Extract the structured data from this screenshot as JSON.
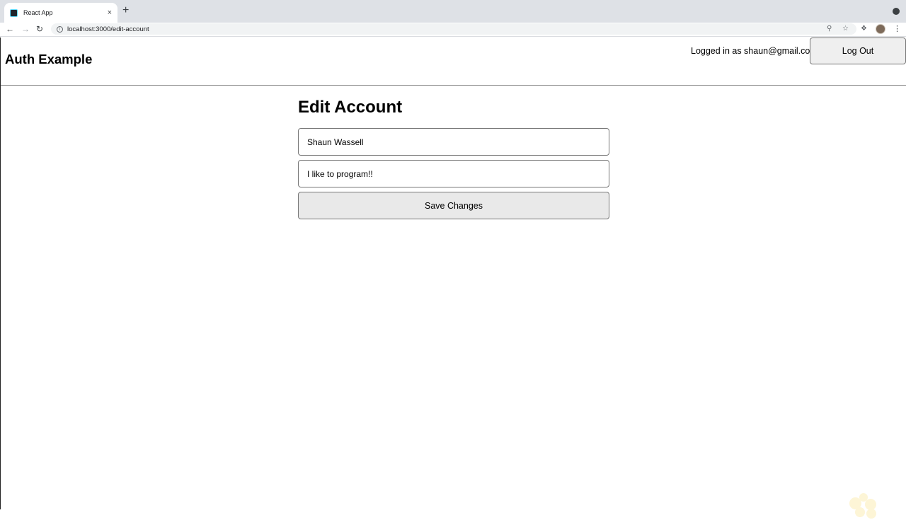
{
  "browser": {
    "tab_title": "React App",
    "tab_close": "×",
    "new_tab": "+",
    "url": "localhost:3000/edit-account",
    "icons": [
      "back-arrow-icon",
      "forward-arrow-icon",
      "reload-icon",
      "info-icon",
      "zoom-icon",
      "star-icon",
      "extensions-icon",
      "profile-avatar",
      "more-menu-icon"
    ]
  },
  "header": {
    "title": "Auth Example",
    "logged_in_text": "Logged in as shaun@gmail.com",
    "logout_label": "Log Out"
  },
  "main": {
    "heading": "Edit Account",
    "name_value": "Shaun Wassell",
    "bio_value": "I like to program!!",
    "save_label": "Save Changes"
  },
  "colors": {
    "tabstrip_bg": "#dee1e6",
    "omnibox_bg": "#f1f3f4",
    "button_bg": "#e9e9e9",
    "border": "#767676"
  }
}
